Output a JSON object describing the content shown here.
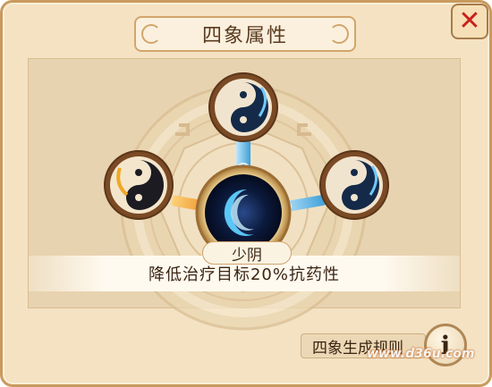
{
  "window": {
    "title": "四象属性",
    "close_icon": "close-icon"
  },
  "nodes": {
    "top": {
      "icon": "yin-yang-blue-icon"
    },
    "left": {
      "icon": "yin-yang-gold-icon"
    },
    "right": {
      "icon": "yin-yang-blue-icon"
    },
    "center": {
      "icon": "blue-crescent-orb-icon",
      "name": "少阴"
    }
  },
  "effect": "降低治疗目标20%抗药性",
  "rules_label": "四象生成规则",
  "info_icon": "info-icon",
  "info_glyph": "i",
  "watermark": "www.d36u.com",
  "colors": {
    "panel_bg": "#f4e2c3",
    "frame": "#c99a5e",
    "close_red": "#c8221a",
    "link_blue": "#5db8e8",
    "link_gold": "#f2a33a"
  }
}
